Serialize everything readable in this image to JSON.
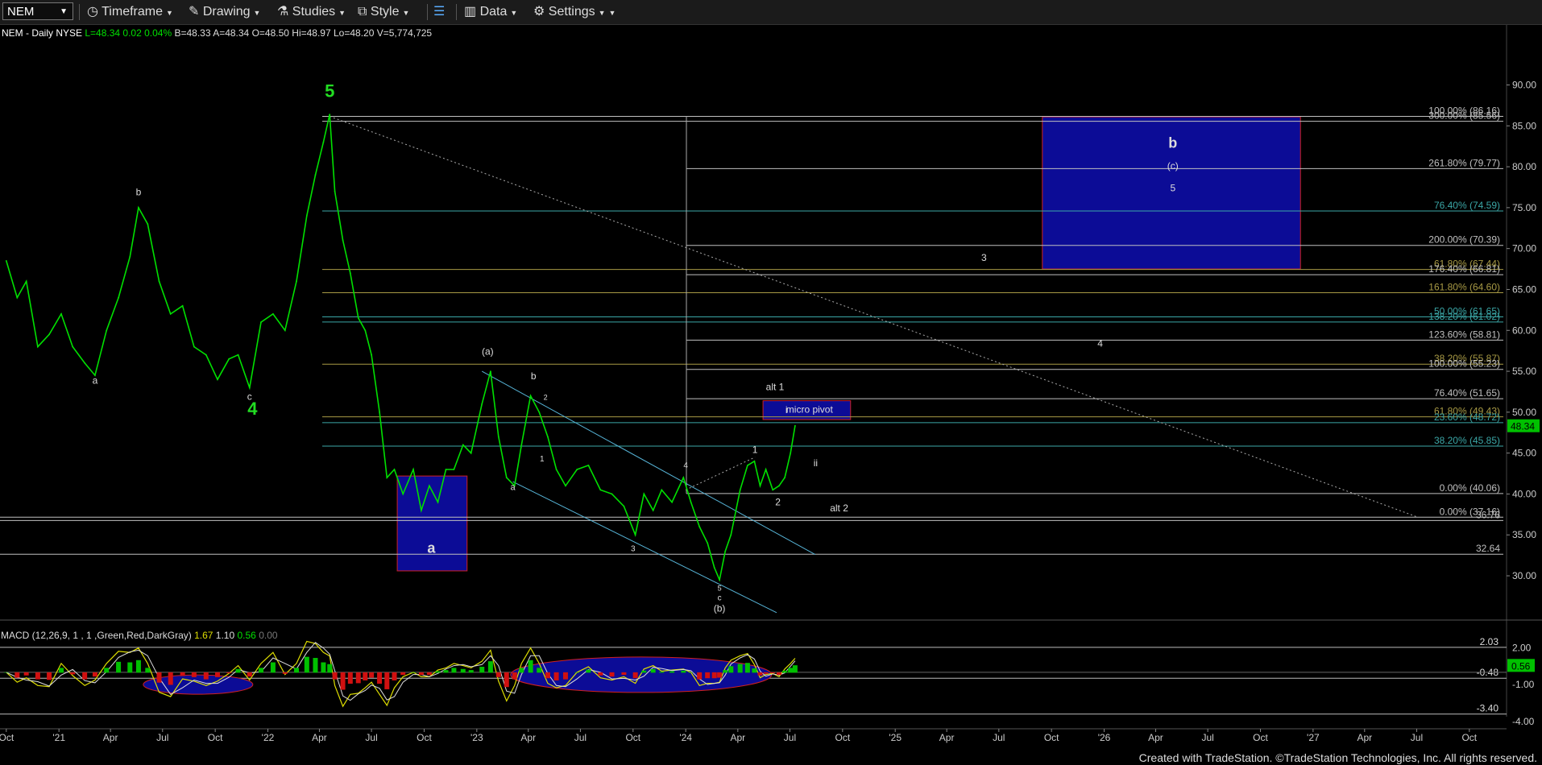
{
  "toolbar": {
    "symbol": "NEM",
    "timeframe": "Timeframe",
    "drawing": "Drawing",
    "studies": "Studies",
    "style": "Style",
    "data": "Data",
    "settings": "Settings"
  },
  "chart_data": {
    "type": "line",
    "header": "NEM - Daily  NYSE",
    "stats": [
      {
        "text": "L=48.34",
        "color": "#00e000"
      },
      {
        "text": "0.02",
        "color": "#00e000"
      },
      {
        "text": "0.04%",
        "color": "#00e000"
      },
      {
        "text": "B=48.33",
        "color": "#dddddd"
      },
      {
        "text": "A=48.34",
        "color": "#dddddd"
      },
      {
        "text": "O=48.50",
        "color": "#dddddd"
      },
      {
        "text": "Hi=48.97",
        "color": "#dddddd"
      },
      {
        "text": "Lo=48.20",
        "color": "#dddddd"
      },
      {
        "text": "V=5,774,725",
        "color": "#dddddd"
      }
    ],
    "price_axis": {
      "min": 24,
      "max": 93,
      "ticks": [
        30,
        35,
        40,
        45,
        50,
        55,
        60,
        65,
        70,
        75,
        80,
        85,
        90
      ],
      "tick_labels": [
        "30.00",
        "35.00",
        "40.00",
        "45.00",
        "50.00",
        "55.00",
        "60.00",
        "65.00",
        "70.00",
        "75.00",
        "80.00",
        "85.00",
        "90.00"
      ]
    },
    "time_axis": {
      "start": "2020-09-20",
      "end": "2027-12-05",
      "labels": [
        {
          "date": "2020-10-01",
          "label": "Oct"
        },
        {
          "date": "2021-01-01",
          "label": "'21"
        },
        {
          "date": "2021-04-01",
          "label": "Apr"
        },
        {
          "date": "2021-07-01",
          "label": "Jul"
        },
        {
          "date": "2021-10-01",
          "label": "Oct"
        },
        {
          "date": "2022-01-01",
          "label": "'22"
        },
        {
          "date": "2022-04-01",
          "label": "Apr"
        },
        {
          "date": "2022-07-01",
          "label": "Jul"
        },
        {
          "date": "2022-10-01",
          "label": "Oct"
        },
        {
          "date": "2023-01-01",
          "label": "'23"
        },
        {
          "date": "2023-04-01",
          "label": "Apr"
        },
        {
          "date": "2023-07-01",
          "label": "Jul"
        },
        {
          "date": "2023-10-01",
          "label": "Oct"
        },
        {
          "date": "2024-01-01",
          "label": "'24"
        },
        {
          "date": "2024-04-01",
          "label": "Apr"
        },
        {
          "date": "2024-07-01",
          "label": "Jul"
        },
        {
          "date": "2024-10-01",
          "label": "Oct"
        },
        {
          "date": "2025-01-01",
          "label": "'25"
        },
        {
          "date": "2025-04-01",
          "label": "Apr"
        },
        {
          "date": "2025-07-01",
          "label": "Jul"
        },
        {
          "date": "2025-10-01",
          "label": "Oct"
        },
        {
          "date": "2026-01-01",
          "label": "'26"
        },
        {
          "date": "2026-04-01",
          "label": "Apr"
        },
        {
          "date": "2026-07-01",
          "label": "Jul"
        },
        {
          "date": "2026-10-01",
          "label": "Oct"
        },
        {
          "date": "2027-01-01",
          "label": "'27"
        },
        {
          "date": "2027-04-01",
          "label": "Apr"
        },
        {
          "date": "2027-07-01",
          "label": "Jul"
        },
        {
          "date": "2027-10-01",
          "label": "Oct"
        }
      ]
    },
    "price_series": {
      "name": "NEM",
      "color": "#00e000",
      "points": [
        [
          "2020-10-01",
          68.5
        ],
        [
          "2020-10-20",
          64
        ],
        [
          "2020-11-05",
          66
        ],
        [
          "2020-11-25",
          58
        ],
        [
          "2020-12-15",
          59.5
        ],
        [
          "2021-01-05",
          62
        ],
        [
          "2021-01-25",
          58
        ],
        [
          "2021-02-15",
          56
        ],
        [
          "2021-03-05",
          54.5
        ],
        [
          "2021-03-25",
          60
        ],
        [
          "2021-04-15",
          64
        ],
        [
          "2021-05-05",
          69
        ],
        [
          "2021-05-20",
          75
        ],
        [
          "2021-06-05",
          73
        ],
        [
          "2021-06-25",
          66
        ],
        [
          "2021-07-15",
          62
        ],
        [
          "2021-08-05",
          63
        ],
        [
          "2021-08-25",
          58
        ],
        [
          "2021-09-15",
          57
        ],
        [
          "2021-10-05",
          54
        ],
        [
          "2021-10-25",
          56.5
        ],
        [
          "2021-11-10",
          57
        ],
        [
          "2021-11-30",
          53
        ],
        [
          "2021-12-20",
          61
        ],
        [
          "2022-01-10",
          62
        ],
        [
          "2022-01-31",
          60
        ],
        [
          "2022-02-20",
          66
        ],
        [
          "2022-03-10",
          74
        ],
        [
          "2022-03-25",
          79
        ],
        [
          "2022-04-08",
          83
        ],
        [
          "2022-04-19",
          86.4
        ],
        [
          "2022-04-28",
          77
        ],
        [
          "2022-05-12",
          71
        ],
        [
          "2022-05-25",
          67
        ],
        [
          "2022-06-08",
          61.5
        ],
        [
          "2022-06-20",
          60
        ],
        [
          "2022-07-01",
          57
        ],
        [
          "2022-07-15",
          50
        ],
        [
          "2022-07-28",
          42
        ],
        [
          "2022-08-10",
          43
        ],
        [
          "2022-08-25",
          40
        ],
        [
          "2022-09-12",
          43
        ],
        [
          "2022-09-26",
          38
        ],
        [
          "2022-10-10",
          41
        ],
        [
          "2022-10-25",
          39
        ],
        [
          "2022-11-08",
          43
        ],
        [
          "2022-11-22",
          43
        ],
        [
          "2022-12-08",
          46
        ],
        [
          "2022-12-22",
          45
        ],
        [
          "2023-01-10",
          51
        ],
        [
          "2023-01-25",
          55
        ],
        [
          "2023-02-08",
          47
        ],
        [
          "2023-02-22",
          42
        ],
        [
          "2023-03-08",
          41
        ],
        [
          "2023-03-20",
          46
        ],
        [
          "2023-04-05",
          52
        ],
        [
          "2023-04-20",
          50
        ],
        [
          "2023-05-05",
          47
        ],
        [
          "2023-05-20",
          43
        ],
        [
          "2023-06-05",
          41
        ],
        [
          "2023-06-25",
          43
        ],
        [
          "2023-07-15",
          43.5
        ],
        [
          "2023-08-05",
          40.5
        ],
        [
          "2023-08-25",
          40
        ],
        [
          "2023-09-15",
          38.5
        ],
        [
          "2023-10-05",
          35
        ],
        [
          "2023-10-20",
          40
        ],
        [
          "2023-11-05",
          38
        ],
        [
          "2023-11-20",
          40.5
        ],
        [
          "2023-12-08",
          39
        ],
        [
          "2023-12-28",
          42
        ],
        [
          "2024-01-10",
          39
        ],
        [
          "2024-01-25",
          36
        ],
        [
          "2024-02-08",
          34
        ],
        [
          "2024-02-20",
          31
        ],
        [
          "2024-02-29",
          29.5
        ],
        [
          "2024-03-10",
          33
        ],
        [
          "2024-03-20",
          35
        ],
        [
          "2024-04-05",
          40.5
        ],
        [
          "2024-04-18",
          43.5
        ],
        [
          "2024-04-30",
          44
        ],
        [
          "2024-05-10",
          41
        ],
        [
          "2024-05-20",
          43
        ],
        [
          "2024-06-01",
          40.5
        ],
        [
          "2024-06-12",
          41
        ],
        [
          "2024-06-22",
          42
        ],
        [
          "2024-07-02",
          45
        ],
        [
          "2024-07-10",
          48.34
        ]
      ]
    },
    "horizontal_levels": [
      {
        "price": 86.16,
        "label": "100.00% (86.16)",
        "color": "#c0c0c0"
      },
      {
        "price": 85.56,
        "label": "300.00% (85.56)",
        "color": "#c0c0c0"
      },
      {
        "price": 79.77,
        "label": "261.80% (79.77)",
        "color": "#c0c0c0"
      },
      {
        "price": 74.59,
        "label": "76.40% (74.59)",
        "color": "#3ba7a7"
      },
      {
        "price": 70.39,
        "label": "200.00% (70.39)",
        "color": "#c0c0c0"
      },
      {
        "price": 67.44,
        "label": "61.80% (67.44)",
        "color": "#a89a45"
      },
      {
        "price": 66.81,
        "label": "176.40% (66.81)",
        "color": "#c0c0c0"
      },
      {
        "price": 64.6,
        "label": "161.80% (64.60)",
        "color": "#a89a45"
      },
      {
        "price": 61.65,
        "label": "50.00% (61.65)",
        "color": "#3ba7a7"
      },
      {
        "price": 61.02,
        "label": "138.20% (61.02)",
        "color": "#3ba7a7"
      },
      {
        "price": 58.81,
        "label": "123.60% (58.81)",
        "color": "#c0c0c0"
      },
      {
        "price": 55.87,
        "label": "38.20% (55.87)",
        "color": "#a89a45"
      },
      {
        "price": 55.23,
        "label": "100.00% (55.23)",
        "color": "#c0c0c0"
      },
      {
        "price": 51.65,
        "label": "76.40% (51.65)",
        "color": "#c0c0c0"
      },
      {
        "price": 49.43,
        "label": "61.80% (49.43)",
        "color": "#a89a45"
      },
      {
        "price": 48.72,
        "label": "23.60% (48.72)",
        "color": "#3ba7a7"
      },
      {
        "price": 45.85,
        "label": "38.20% (45.85)",
        "color": "#3ba7a7"
      },
      {
        "price": 40.06,
        "label": "0.00% (40.06)",
        "color": "#c0c0c0"
      },
      {
        "price": 37.16,
        "label": "0.00% (37.16)",
        "color": "#c0c0c0"
      },
      {
        "price": 36.76,
        "label": "36.76",
        "color": "#c0c0c0"
      },
      {
        "price": 32.64,
        "label": "32.64",
        "color": "#c0c0c0"
      }
    ],
    "boxes": [
      {
        "from": "2022-08-15",
        "to": "2022-12-15",
        "low": 30.6,
        "high": 42.2,
        "label": "a"
      },
      {
        "from": "2024-05-15",
        "to": "2024-10-15",
        "low": 49.1,
        "high": 51.4,
        "label": "micro pivot"
      },
      {
        "from": "2025-09-15",
        "to": "2026-12-10",
        "low": 67.5,
        "high": 86.1,
        "label": "b"
      }
    ],
    "wave_labels": [
      {
        "date": "2022-04-19",
        "price": 88.5,
        "text": "5",
        "color": "#22dd22",
        "size": 22
      },
      {
        "date": "2021-12-05",
        "price": 49.7,
        "text": "4",
        "color": "#22dd22",
        "size": 22
      },
      {
        "date": "2021-05-20",
        "price": 76.5,
        "text": "b",
        "color": "#dddddd",
        "size": 12
      },
      {
        "date": "2021-03-05",
        "price": 53.5,
        "text": "a",
        "color": "#dddddd",
        "size": 12
      },
      {
        "date": "2021-11-30",
        "price": 51.5,
        "text": "c",
        "color": "#dddddd",
        "size": 12
      },
      {
        "date": "2023-01-20",
        "price": 57,
        "text": "(a)",
        "color": "#dddddd",
        "size": 12
      },
      {
        "date": "2023-04-10",
        "price": 54,
        "text": "b",
        "color": "#dddddd",
        "size": 12
      },
      {
        "date": "2023-03-05",
        "price": 40.5,
        "text": "a",
        "color": "#dddddd",
        "size": 11
      },
      {
        "date": "2023-05-01",
        "price": 51.5,
        "text": "2",
        "color": "#dddddd",
        "size": 9
      },
      {
        "date": "2023-04-25",
        "price": 44,
        "text": "1",
        "color": "#dddddd",
        "size": 10
      },
      {
        "date": "2023-10-01",
        "price": 33,
        "text": "3",
        "color": "#dddddd",
        "size": 10
      },
      {
        "date": "2024-01-01",
        "price": 43.2,
        "text": "4",
        "color": "#dddddd",
        "size": 10
      },
      {
        "date": "2024-02-29",
        "price": 28.2,
        "text": "5",
        "color": "#dddddd",
        "size": 9
      },
      {
        "date": "2024-02-29",
        "price": 27.0,
        "text": "c",
        "color": "#dddddd",
        "size": 10
      },
      {
        "date": "2024-02-29",
        "price": 25.6,
        "text": "(b)",
        "color": "#dddddd",
        "size": 12
      },
      {
        "date": "2024-05-01",
        "price": 45,
        "text": "1",
        "color": "#dddddd",
        "size": 12
      },
      {
        "date": "2024-06-10",
        "price": 38.6,
        "text": "2",
        "color": "#dddddd",
        "size": 12
      },
      {
        "date": "2024-06-25",
        "price": 49.9,
        "text": "i",
        "color": "#dddddd",
        "size": 12
      },
      {
        "date": "2024-08-15",
        "price": 43.4,
        "text": "ii",
        "color": "#dddddd",
        "size": 12
      },
      {
        "date": "2024-06-05",
        "price": 52.7,
        "text": "alt 1",
        "color": "#dddddd",
        "size": 12
      },
      {
        "date": "2024-09-25",
        "price": 37.9,
        "text": "alt 2",
        "color": "#dddddd",
        "size": 12
      },
      {
        "date": "2025-06-05",
        "price": 68.5,
        "text": "3",
        "color": "#dddddd",
        "size": 12
      },
      {
        "date": "2025-12-25",
        "price": 58,
        "text": "4",
        "color": "#dddddd",
        "size": 12
      },
      {
        "date": "2026-05-01",
        "price": 77,
        "text": "5",
        "color": "#dddddd",
        "size": 12
      },
      {
        "date": "2026-05-01",
        "price": 79.7,
        "text": "(c)",
        "color": "#dddddd",
        "size": 12
      },
      {
        "date": "2026-05-01",
        "price": 82.3,
        "text": "b",
        "color": "#dddddd",
        "size": 18
      }
    ],
    "macd": {
      "title": "MACD (12,26,9, 1 , 1 ,Green,Red,DarkGray)",
      "values_shown": [
        {
          "text": "1.67",
          "color": "#dddd00"
        },
        {
          "text": "1.10",
          "color": "#dddddd"
        },
        {
          "text": "0.56",
          "color": "#00e000"
        },
        {
          "text": "0.00",
          "color": "#777777"
        }
      ],
      "axis": {
        "min": -4.6,
        "max": 3.6,
        "ticks": [
          2.0,
          -1.0,
          -4.0
        ],
        "tick_labels": [
          "2.00",
          "-1.00",
          "-4.00"
        ]
      },
      "levels": [
        {
          "value": 2.03,
          "label": "2.03"
        },
        {
          "value": -0.48,
          "label": "-0.48"
        },
        {
          "value": -3.4,
          "label": "-3.40"
        }
      ],
      "current": {
        "value": 0.56,
        "label": "0.56"
      }
    },
    "last_price": {
      "value": 48.34,
      "label": "48.34"
    }
  },
  "footer": {
    "text": "Created with TradeStation. ©TradeStation Technologies, Inc. All rights reserved."
  }
}
